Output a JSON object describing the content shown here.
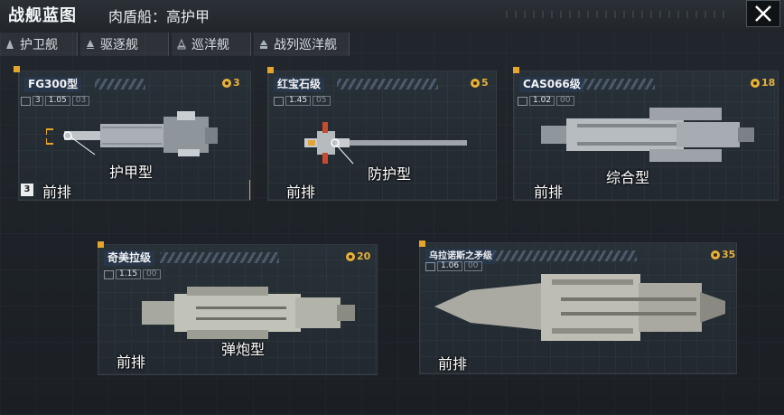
{
  "header": {
    "title": "战舰蓝图",
    "subtitle": "肉盾船：高护甲"
  },
  "tabs": [
    {
      "label": "护卫舰"
    },
    {
      "label": "驱逐舰"
    },
    {
      "label": "巡洋舰"
    },
    {
      "label": "战列巡洋舰"
    }
  ],
  "cards": [
    {
      "name": "FG300型",
      "cost": "3",
      "stat_num": "3",
      "stat_val": "1.05",
      "stat_sub": "03",
      "role": "护甲型",
      "row": "前排",
      "row_num": "3"
    },
    {
      "name": "红宝石级",
      "cost": "5",
      "stat_val": "1.45",
      "stat_sub": "05",
      "role": "防护型",
      "row": "前排"
    },
    {
      "name": "CAS066级",
      "cost": "18",
      "stat_val": "1.02",
      "stat_sub": "00",
      "role": "综合型",
      "row": "前排"
    },
    {
      "name": "奇美拉级",
      "cost": "20",
      "stat_val": "1.15",
      "stat_sub": "00",
      "role": "弹炮型",
      "row": "前排"
    },
    {
      "name": "乌拉诺斯之矛级",
      "cost": "35",
      "stat_val": "1.06",
      "stat_sub": "00",
      "row": "前排"
    }
  ],
  "colors": {
    "accent": "#e5a52b",
    "background": "#1d2126",
    "card": "#262d34"
  },
  "icons": {
    "close": "close-icon",
    "tab": "hull-class-icon",
    "cost": "credit-coin-icon"
  }
}
